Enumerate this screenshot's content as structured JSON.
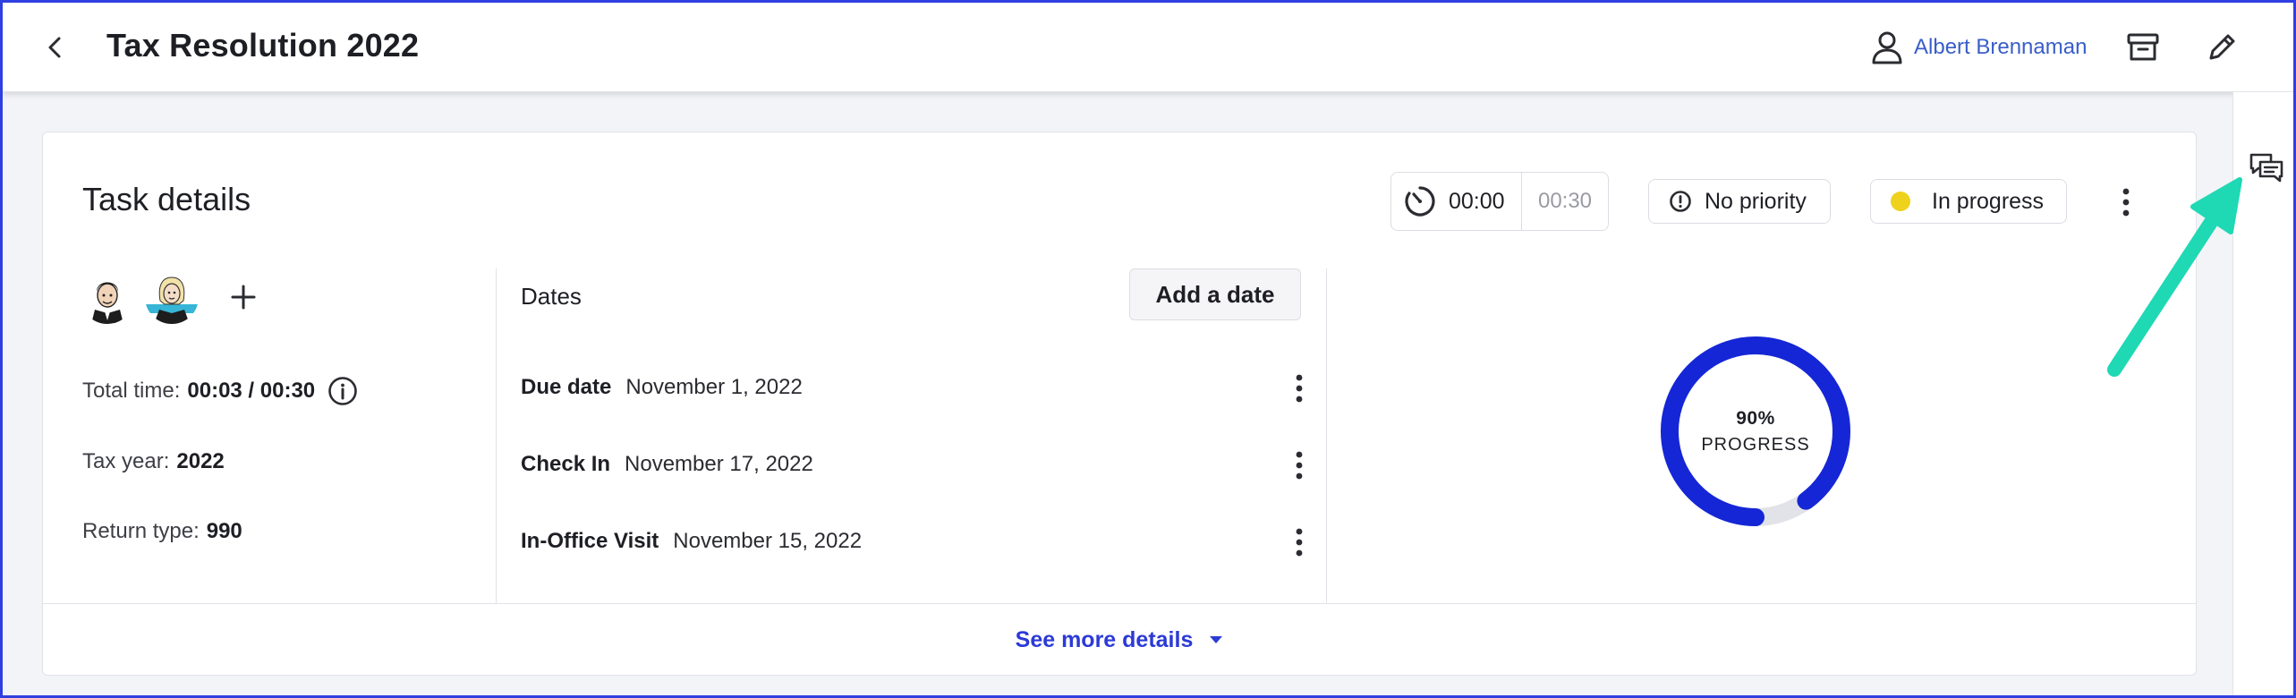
{
  "header": {
    "title": "Tax Resolution 2022",
    "assignee": "Albert Brennaman"
  },
  "task": {
    "card_title": "Task details",
    "timer": {
      "elapsed": "00:00",
      "estimate": "00:30"
    },
    "priority": "No priority",
    "status": "In progress",
    "status_color": "#eed21c",
    "total_time": {
      "label": "Total time:",
      "value": "00:03 / 00:30"
    },
    "tax_year": {
      "label": "Tax year:",
      "value": "2022"
    },
    "return_type": {
      "label": "Return type:",
      "value": "990"
    }
  },
  "dates": {
    "title": "Dates",
    "add_button": "Add a date",
    "rows": [
      {
        "label": "Due date",
        "value": "November 1, 2022"
      },
      {
        "label": "Check In",
        "value": "November 17, 2022"
      },
      {
        "label": "In-Office Visit",
        "value": "November 15, 2022"
      }
    ]
  },
  "progress": {
    "percent_text": "90%",
    "label": "PROGRESS",
    "fraction": 0.9,
    "color": "#1526d6"
  },
  "footer": {
    "see_more": "See more details"
  },
  "colors": {
    "accent": "#2c3ad6",
    "annotation_arrow": "#1fd8b4"
  }
}
